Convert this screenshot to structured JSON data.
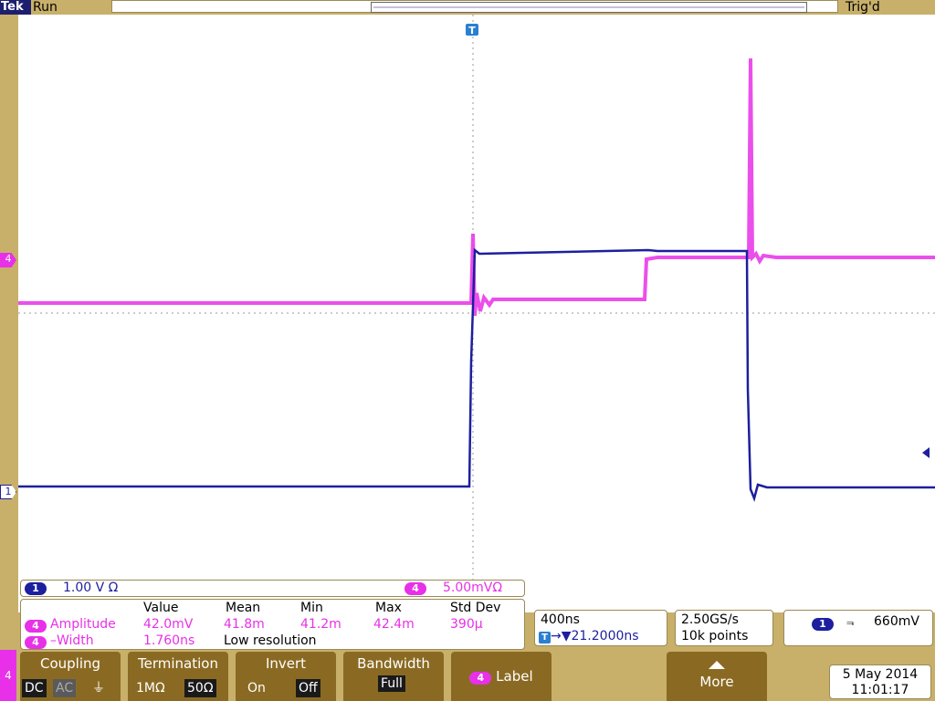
{
  "status": {
    "brand": "Tek",
    "run_state": "Run",
    "trigger_state": "Trig'd"
  },
  "markers": {
    "ch4": "4",
    "ch1": "1",
    "trigger": "T"
  },
  "scale": {
    "ch1_label": "1",
    "ch1_value": "1.00 V  Ω",
    "ch4_label": "4",
    "ch4_value": "5.00mVΩ"
  },
  "measurements": {
    "headers": [
      "Value",
      "Mean",
      "Min",
      "Max",
      "Std Dev"
    ],
    "rows": [
      {
        "ch": "4",
        "name": "Amplitude",
        "value": "42.0mV",
        "mean": "41.8m",
        "min": "41.2m",
        "max": "42.4m",
        "std": "390µ"
      },
      {
        "ch": "4",
        "name": "–Width",
        "value": "1.760ns",
        "note": "Low resolution"
      }
    ]
  },
  "horizontal": {
    "scale": "400ns",
    "position": "→▼21.2000ns"
  },
  "acquisition": {
    "rate": "2.50GS/s",
    "points": "10k points"
  },
  "trigger": {
    "ch": "1",
    "slope": "⫬",
    "level": "660mV"
  },
  "menu": {
    "channel": "4",
    "coupling": {
      "title": "Coupling",
      "options": [
        "DC",
        "AC",
        "⏚"
      ],
      "selected": "DC"
    },
    "termination": {
      "title": "Termination",
      "options": [
        "1MΩ",
        "50Ω"
      ],
      "selected": "50Ω"
    },
    "invert": {
      "title": "Invert",
      "options": [
        "On",
        "Off"
      ],
      "selected": "Off"
    },
    "bandwidth": {
      "title": "Bandwidth",
      "value": "Full"
    },
    "label": {
      "ch": "4",
      "title": "Label"
    },
    "more": {
      "title": "More"
    }
  },
  "datetime": {
    "date": "5 May 2014",
    "time": "11:01:17"
  },
  "colors": {
    "ch1": "#1d1f9e",
    "ch4": "#e830e8",
    "bezel": "#c8b06a",
    "menu": "#8a6a22"
  }
}
